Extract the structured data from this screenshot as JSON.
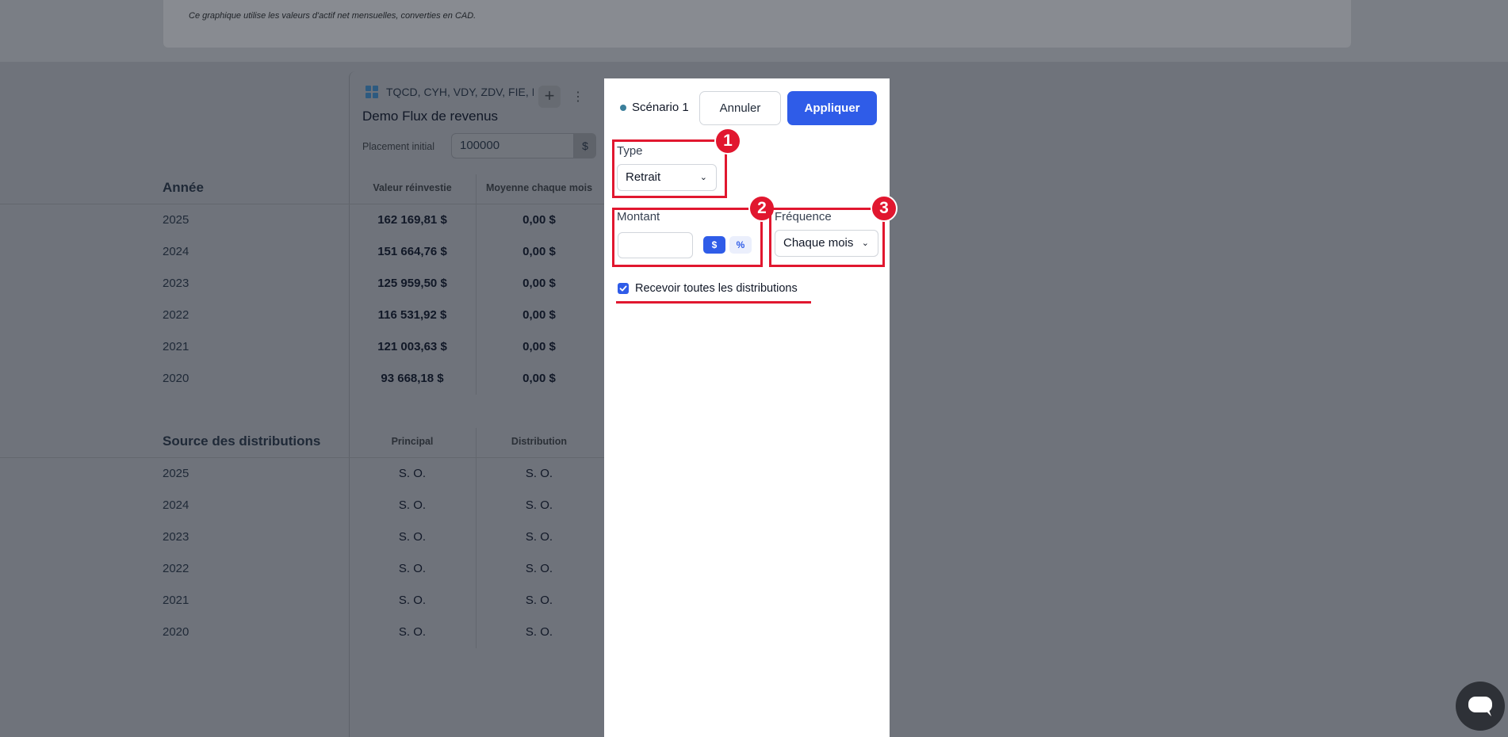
{
  "top_note": "Ce graphique utilise les valeurs d'actif net mensuelles, converties en CAD.",
  "scenario_panel": {
    "tickers": "TQCD, CYH, VDY, ZDV, FIE, I",
    "name": "Demo Flux de revenus",
    "initial_label": "Placement initial",
    "initial_value": "100000",
    "initial_unit": "$"
  },
  "year_table": {
    "title": "Année",
    "columns": [
      "Valeur réinvestie",
      "Moyenne chaque mois"
    ],
    "rows": [
      {
        "year": "2025",
        "reinvested": "162 169,81 $",
        "monthly": "0,00 $"
      },
      {
        "year": "2024",
        "reinvested": "151 664,76 $",
        "monthly": "0,00 $"
      },
      {
        "year": "2023",
        "reinvested": "125 959,50 $",
        "monthly": "0,00 $"
      },
      {
        "year": "2022",
        "reinvested": "116 531,92 $",
        "monthly": "0,00 $"
      },
      {
        "year": "2021",
        "reinvested": "121 003,63 $",
        "monthly": "0,00 $"
      },
      {
        "year": "2020",
        "reinvested": "93 668,18 $",
        "monthly": "0,00 $"
      }
    ]
  },
  "source_table": {
    "title": "Source des distributions",
    "columns": [
      "Principal",
      "Distribution"
    ],
    "rows": [
      {
        "year": "2025",
        "principal": "S. O.",
        "distribution": "S. O."
      },
      {
        "year": "2024",
        "principal": "S. O.",
        "distribution": "S. O."
      },
      {
        "year": "2023",
        "principal": "S. O.",
        "distribution": "S. O."
      },
      {
        "year": "2022",
        "principal": "S. O.",
        "distribution": "S. O."
      },
      {
        "year": "2021",
        "principal": "S. O.",
        "distribution": "S. O."
      },
      {
        "year": "2020",
        "principal": "S. O.",
        "distribution": "S. O."
      }
    ]
  },
  "modal": {
    "scenario_label": "Scénario 1",
    "cancel_label": "Annuler",
    "apply_label": "Appliquer",
    "type_label": "Type",
    "type_value": "Retrait",
    "amount_label": "Montant",
    "amount_value": "",
    "unit_dollar": "$",
    "unit_percent": "%",
    "frequency_label": "Fréquence",
    "frequency_value": "Chaque mois",
    "checkbox_label": "Recevoir toutes les distributions",
    "checkbox_checked": true
  },
  "annotations": [
    "1",
    "2",
    "3"
  ],
  "colors": {
    "primary": "#2f5ce8",
    "annotation": "#e1172f",
    "overlay": "#6f737b"
  }
}
